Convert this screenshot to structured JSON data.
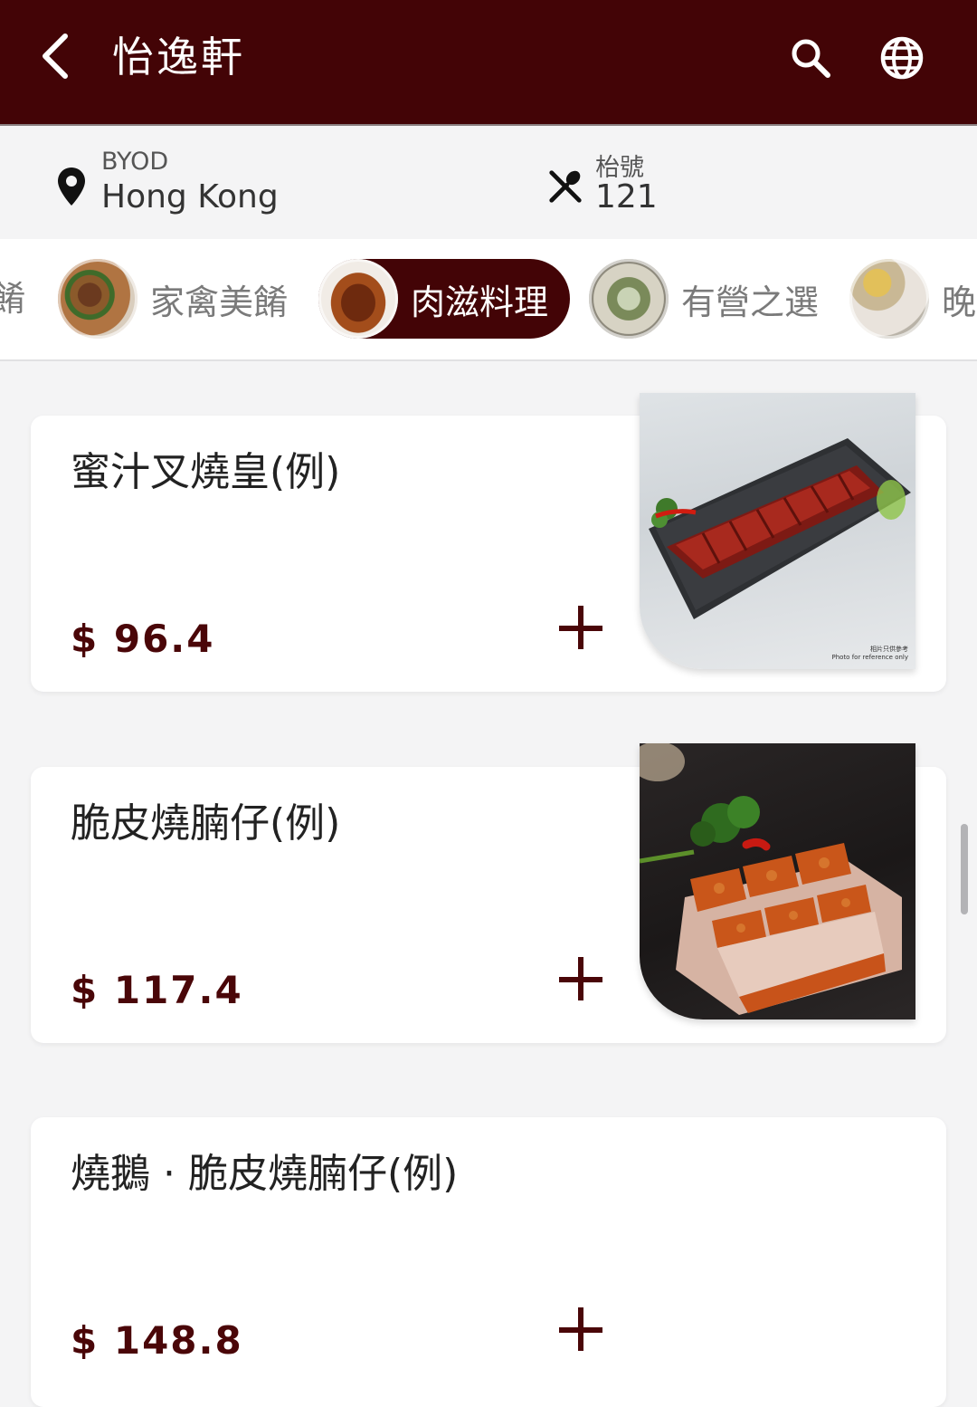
{
  "header": {
    "title": "怡逸軒",
    "back_icon": "chevron-left-icon",
    "search_icon": "search-icon",
    "language_icon": "globe-icon",
    "background": "#430406"
  },
  "info": {
    "location_icon": "map-pin-icon",
    "mode": "BYOD",
    "location": "Hong Kong",
    "table_icon": "utensils-icon",
    "table_label": "枱號",
    "table_number": "121"
  },
  "categories": {
    "partial_left": "餚",
    "items": [
      {
        "label": "家禽美餚",
        "active": false
      },
      {
        "label": "肉滋料理",
        "active": true
      },
      {
        "label": "有營之選",
        "active": false
      },
      {
        "label": "晚",
        "active": false
      }
    ]
  },
  "menu_items": [
    {
      "name": "蜜汁叉燒皇(例)",
      "price": "$ 96.4",
      "has_image": true
    },
    {
      "name": "脆皮燒腩仔(例)",
      "price": "$ 117.4",
      "has_image": true
    },
    {
      "name": "燒鵝 · 脆皮燒腩仔(例)",
      "price": "$ 148.8",
      "has_image": false
    }
  ],
  "image_notes": {
    "charsiu": "相片只供參考\nPhoto for reference only"
  },
  "colors": {
    "accent": "#430406",
    "price": "#4a0608",
    "background": "#f4f4f5"
  }
}
